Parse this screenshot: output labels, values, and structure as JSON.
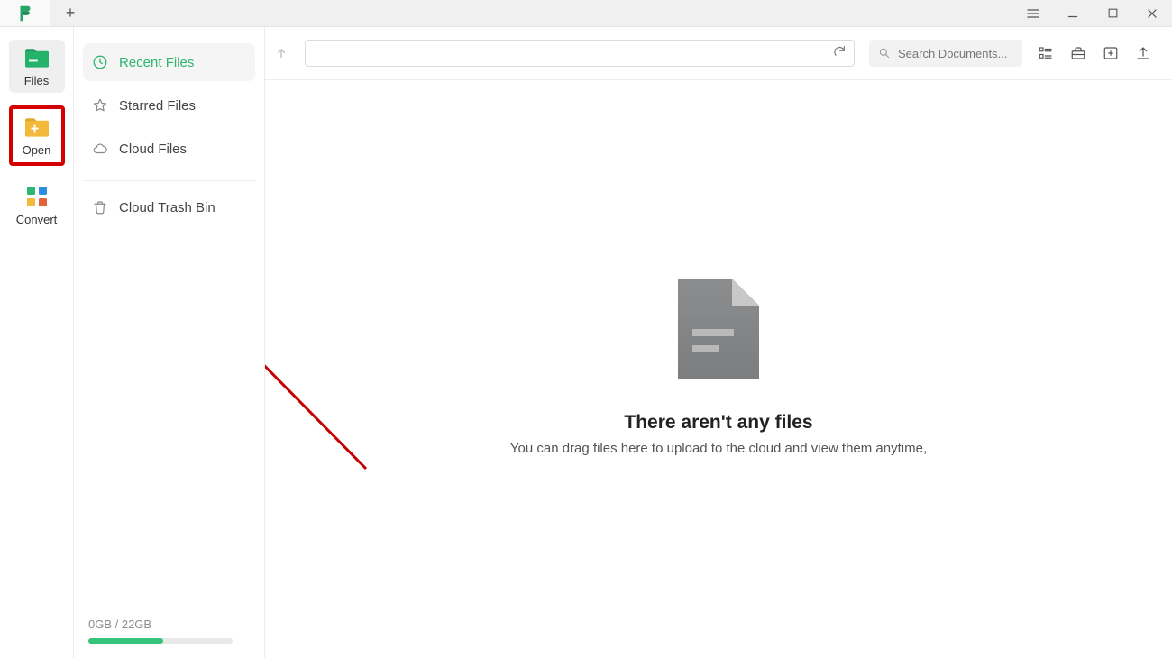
{
  "titlebar": {
    "plus": "+"
  },
  "rail": {
    "files_label": "Files",
    "open_label": "Open",
    "convert_label": "Convert"
  },
  "panel": {
    "recent": "Recent Files",
    "starred": "Starred Files",
    "cloud": "Cloud Files",
    "trash": "Cloud Trash Bin"
  },
  "storage": {
    "text": "0GB / 22GB"
  },
  "search": {
    "placeholder": "Search Documents..."
  },
  "empty": {
    "title": "There aren't any files",
    "subtitle": "You can drag files here to upload to the cloud and view them anytime,"
  }
}
